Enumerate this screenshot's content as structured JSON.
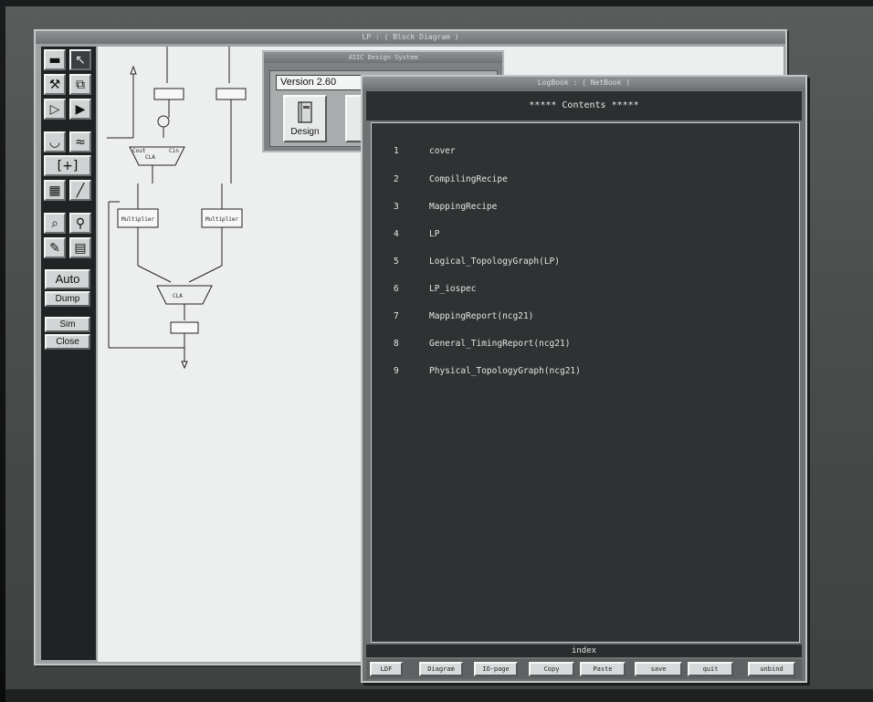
{
  "back_window": {
    "title": "LP : ( Block Diagram )",
    "palette_buttons": {
      "auto": "Auto",
      "dump": "Dump",
      "sim": "Sim",
      "close": "Close"
    },
    "diagram_labels": {
      "cla": "CLA",
      "multiplier": "Multiplier",
      "cout": "Cout",
      "cin": "Cin"
    }
  },
  "design_window": {
    "title": "ASIC Design System",
    "version": "Version 2.60",
    "design_label": "Design"
  },
  "front_window": {
    "title": "LogBook : ( NetBook )",
    "header": "***** Contents *****",
    "items": [
      {
        "num": "1",
        "label": "cover"
      },
      {
        "num": "2",
        "label": "CompilingRecipe"
      },
      {
        "num": "3",
        "label": "MappingRecipe"
      },
      {
        "num": "4",
        "label": "LP"
      },
      {
        "num": "5",
        "label": "Logical_TopologyGraph(LP)"
      },
      {
        "num": "6",
        "label": "LP_iospec"
      },
      {
        "num": "7",
        "label": "MappingReport(ncg21)"
      },
      {
        "num": "8",
        "label": "General_TimingReport(ncg21)"
      },
      {
        "num": "9",
        "label": "Physical_TopologyGraph(ncg21)"
      }
    ],
    "index_label": "index",
    "buttons": [
      "LDF",
      "Diagram",
      "IO-page",
      "Copy",
      "Paste",
      "save",
      "quit",
      "unbind"
    ]
  }
}
